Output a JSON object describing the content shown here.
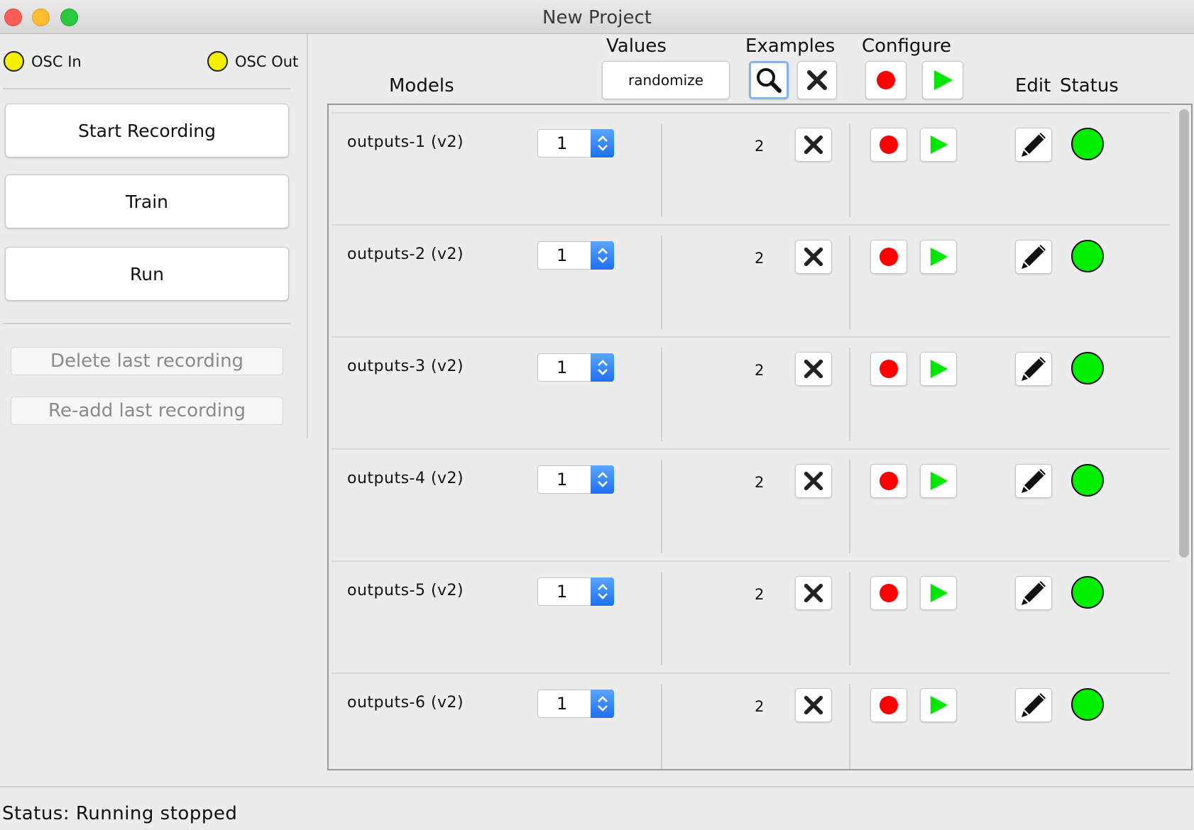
{
  "window": {
    "title": "New Project"
  },
  "osc": {
    "in_label": "OSC In",
    "out_label": "OSC Out",
    "led_color": "#f5f000"
  },
  "actions": {
    "start_recording": "Start Recording",
    "train": "Train",
    "run": "Run",
    "delete_last": "Delete last recording",
    "readd_last": "Re-add last recording"
  },
  "headers": {
    "models": "Models",
    "values": "Values",
    "randomize": "randomize",
    "examples": "Examples",
    "configure": "Configure",
    "edit": "Edit",
    "status": "Status"
  },
  "colors": {
    "record": "#ff0000",
    "play": "#00e600",
    "status_ok": "#00f000",
    "stepper": "#1f6ff2"
  },
  "icons": {
    "search": "search-icon",
    "delete": "x-icon",
    "record": "record-icon",
    "play": "play-icon",
    "edit": "pencil-icon"
  },
  "models": [
    {
      "name": "outputs-1 (v2)",
      "value": "1",
      "examples": "2"
    },
    {
      "name": "outputs-2 (v2)",
      "value": "1",
      "examples": "2"
    },
    {
      "name": "outputs-3 (v2)",
      "value": "1",
      "examples": "2"
    },
    {
      "name": "outputs-4 (v2)",
      "value": "1",
      "examples": "2"
    },
    {
      "name": "outputs-5 (v2)",
      "value": "1",
      "examples": "2"
    },
    {
      "name": "outputs-6 (v2)",
      "value": "1",
      "examples": "2"
    }
  ],
  "statusbar": {
    "label": "Status:",
    "text": "Running stopped"
  }
}
